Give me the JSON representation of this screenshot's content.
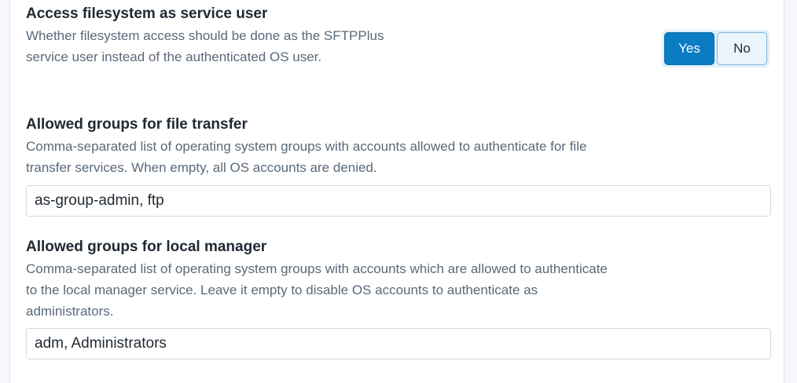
{
  "settings": {
    "service_user": {
      "title": "Access filesystem as service user",
      "description": "Whether filesystem access should be done as the SFTPPlus service user instead of the authenticated OS user.",
      "options": [
        "Yes",
        "No"
      ],
      "selected": "Yes"
    },
    "file_transfer_groups": {
      "title": "Allowed groups for file transfer",
      "description": "Comma-separated list of operating system groups with accounts allowed to authenticate for file transfer services. When empty, all OS accounts are denied.",
      "value": "as-group-admin, ftp"
    },
    "local_manager_groups": {
      "title": "Allowed groups for local manager",
      "description": "Comma-separated list of operating system groups with accounts which are allowed to authenticate to the local manager service. Leave it empty to disable OS accounts to authenticate as administrators.",
      "value": "adm, Administrators"
    }
  },
  "colors": {
    "accent": "#0a7cc4",
    "toggle_background": "#e3f0f9",
    "title_text": "#1f2933",
    "description_text": "#5a6978"
  }
}
